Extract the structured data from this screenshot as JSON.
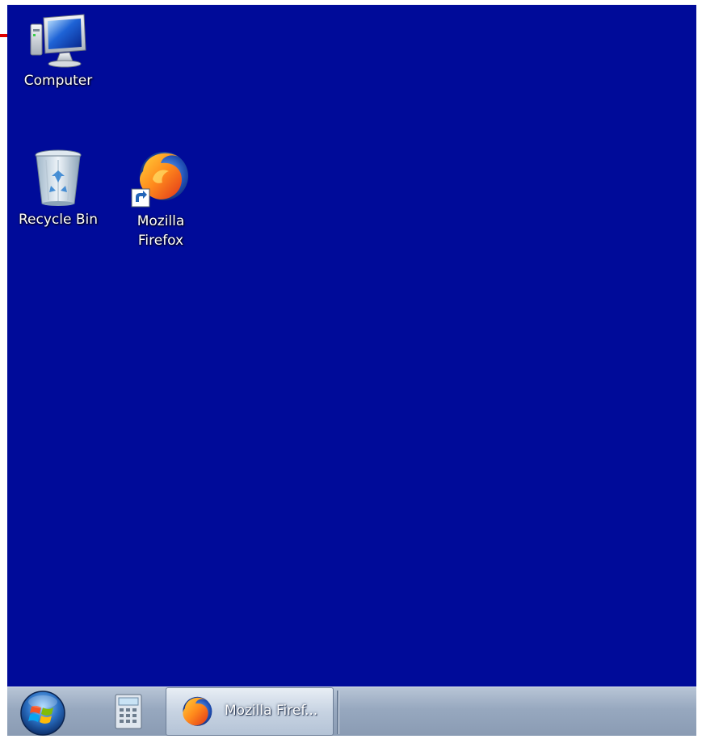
{
  "desktop": {
    "background_color": "#000b99",
    "icons": [
      {
        "name": "computer-icon",
        "label": "Computer"
      },
      {
        "name": "recycle-bin-icon",
        "label": "Recycle Bin"
      },
      {
        "name": "firefox-icon",
        "label_line1": "Mozilla",
        "label_line2": "Firefox"
      }
    ]
  },
  "taskbar": {
    "start_icon": "windows-logo-icon",
    "pinned": [
      {
        "name": "calculator-icon"
      }
    ],
    "open_windows": [
      {
        "name": "firefox-icon",
        "label": "Mozilla Firef..."
      }
    ]
  },
  "colors": {
    "accent_arrow": "#e00000",
    "taskbar": "#97a8bf"
  }
}
